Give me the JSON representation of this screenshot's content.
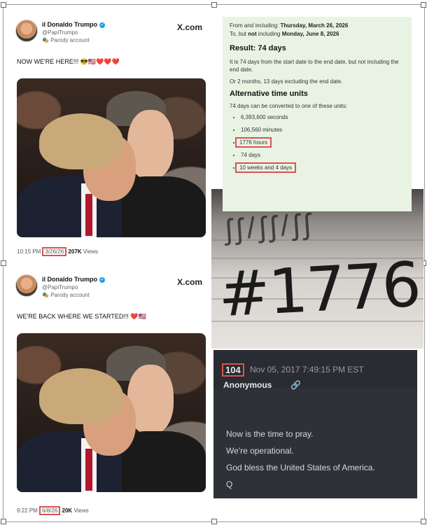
{
  "tweets": [
    {
      "name": "il Donaldo Trumpo",
      "handle": "@PapiTrumpo",
      "parody": "Parody account",
      "site": "X.com",
      "text": "NOW WE'RE HERE!!! 😎🇺🇸❤️❤️❤️",
      "time": "10:15 PM",
      "date": "3/26/26",
      "views_count": "207K",
      "views_label": "Views"
    },
    {
      "name": "il Donaldo Trumpo",
      "handle": "@PapiTrumpo",
      "parody": "Parody account",
      "site": "X.com",
      "text": "WE'RE BACK WHERE WE STARTED!!! ❤️🇺🇸",
      "time": "9:22 PM",
      "date": "6/8/26",
      "views_count": "20K",
      "views_label": "Views"
    }
  ],
  "calculator": {
    "from_prefix": "From and including:",
    "from_date": "Thursday, March 26, 2026",
    "to_prefix": "To, but",
    "to_not": "not",
    "to_mid": "including",
    "to_date": "Monday, June 8, 2026",
    "result": "Result: 74 days",
    "para1": "It is 74 days from the start date to the end date, but not including the end date.",
    "para2": "Or 2 months, 13 days excluding the end date.",
    "alt_heading": "Alternative time units",
    "alt_intro": "74 days can be converted to one of these units:",
    "units": [
      "6,393,600 seconds",
      "106,560 minutes",
      "1776 hours",
      "74 days",
      "10 weeks and 4 days"
    ]
  },
  "paper": {
    "scrawl": "ʃʃ/ʃʃ/ʃʃ",
    "big": "#1776"
  },
  "qpost": {
    "number": "104",
    "date": "Nov 05, 2017 7:49:15 PM EST",
    "author": "Anonymous",
    "link_icon": "🔗",
    "lines": [
      "Now is the time to pray.",
      "We're operational.",
      "God bless the United States of America.",
      "Q"
    ]
  }
}
